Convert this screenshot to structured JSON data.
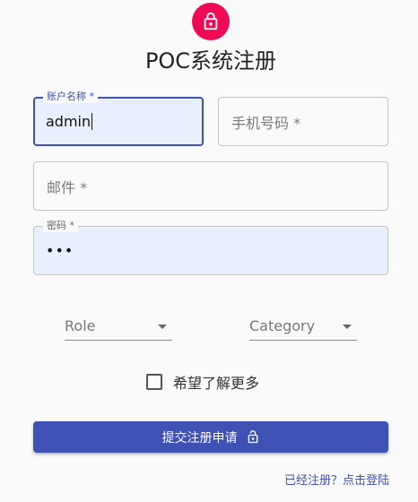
{
  "header": {
    "icon": "lock-icon",
    "title": "POC系统注册"
  },
  "form": {
    "username": {
      "label": "账户名称 *",
      "value": "admin"
    },
    "phone": {
      "placeholder": "手机号码 *"
    },
    "email": {
      "placeholder": "邮件 *"
    },
    "password": {
      "label": "密码 *",
      "masked_value": "•••"
    },
    "role": {
      "label": "Role"
    },
    "category": {
      "label": "Category"
    },
    "newsletter": {
      "label": "希望了解更多",
      "checked": false
    },
    "submit": {
      "label": "提交注册申请",
      "icon": "lock-open-icon"
    },
    "login_link": "已经注册？点击登陆"
  },
  "colors": {
    "accent": "#ef0a56",
    "primary": "#3f51b5",
    "autofill_background": "#e8f0fe"
  }
}
